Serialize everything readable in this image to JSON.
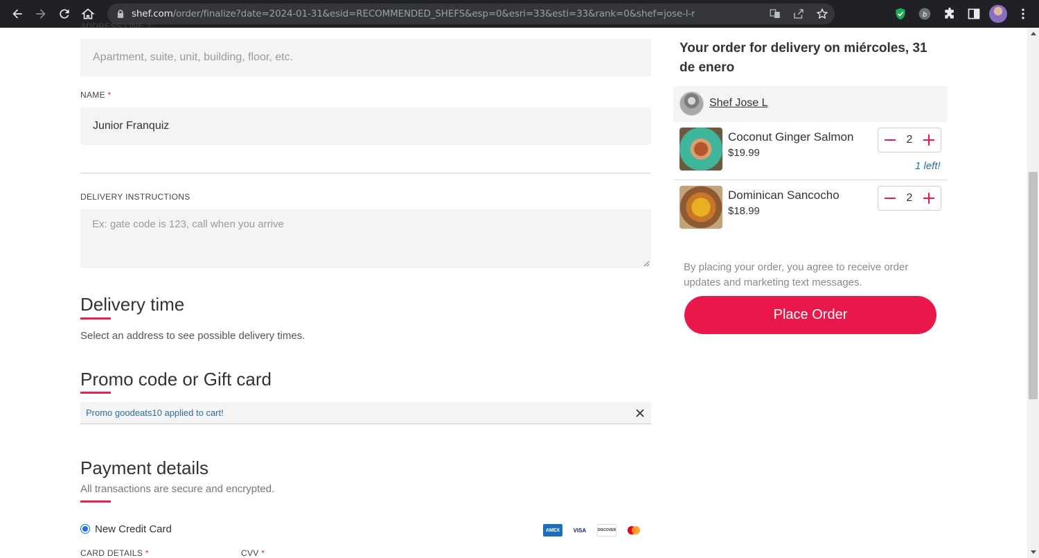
{
  "browser": {
    "url_host": "shef.com",
    "url_path": "/order/finalize?date=2024-01-31&esid=RECOMMENDED_SHEFS&esp=0&esri=33&esti=33&rank=0&shef=jose-l-r"
  },
  "form": {
    "address_line2_label": "ADDRESS LINE 2",
    "address_line2_placeholder": "Apartment, suite, unit, building, floor, etc.",
    "name_label": "NAME",
    "name_value": "Junior Franquiz",
    "delivery_instructions_label": "DELIVERY INSTRUCTIONS",
    "delivery_instructions_placeholder": "Ex: gate code is 123, call when you arrive",
    "required_mark": "*"
  },
  "delivery_time": {
    "title": "Delivery time",
    "subtitle": "Select an address to see possible delivery times."
  },
  "promo": {
    "title": "Promo code or Gift card",
    "message": "Promo goodeats10 applied to cart!"
  },
  "payment": {
    "title": "Payment details",
    "subtitle": "All transactions are secure and encrypted.",
    "option_label": "New Credit Card",
    "card_details_label": "CARD DETAILS",
    "cvv_label": "CVV",
    "card_brands": [
      "AMEX",
      "VISA",
      "DISCOVER",
      "MASTERCARD"
    ]
  },
  "order": {
    "title": "Your order for delivery on miércoles, 31 de enero",
    "shef_name": "Shef Jose L",
    "items": [
      {
        "name": "Coconut Ginger Salmon",
        "price": "$19.99",
        "quantity": "2",
        "note": "1 left!"
      },
      {
        "name": "Dominican Sancocho",
        "price": "$18.99",
        "quantity": "2"
      }
    ],
    "legal_text": "By placing your order, you agree to receive order updates and marketing text messages.",
    "place_order_label": "Place Order"
  },
  "colors": {
    "brand_red": "#e8194a",
    "link_blue": "#2e6e9e"
  }
}
